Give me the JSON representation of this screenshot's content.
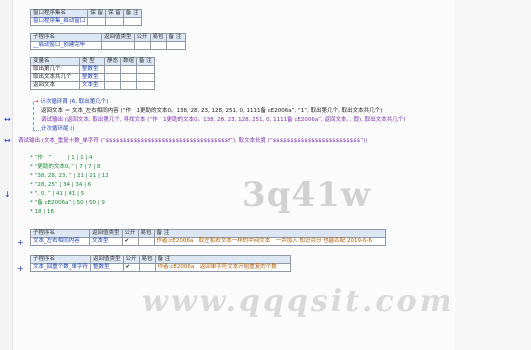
{
  "window_table": {
    "headers": [
      "窗口程序集名",
      "保 留",
      "保 留",
      "备 注"
    ],
    "row": [
      "窗口程序集_启动窗口",
      "",
      "",
      ""
    ]
  },
  "sub_table": {
    "headers": [
      "子程序名",
      "返回值类型",
      "公开",
      "易包",
      "备 注"
    ],
    "row": [
      "__启动窗口_创建完毕",
      "",
      "",
      "",
      ""
    ]
  },
  "var_table": {
    "headers": [
      "变量名",
      "类 型",
      "静态",
      "数组",
      "备 注"
    ],
    "rows": [
      [
        "取出第几个",
        "整数型",
        "",
        "",
        ""
      ],
      [
        "取出文本共几个",
        "整数型",
        "",
        "",
        ""
      ],
      [
        "返回文本",
        "文本型",
        "",
        "",
        ""
      ]
    ]
  },
  "code": {
    "loop_start": "计次循环首 (6, 取出第几个)",
    "line2": "返回文本 ＝ 文本_左右相同内容 (“作　1更助的文本0。138, 28, 23, 128, 251, 0, 1111备 cE2006a”, “1”, 取出第几个, 取出文本共几个)",
    "line3": "调试输出 (返回文本, 取出第几个, 寻找文本 (“作　1更助的文本0。138, 28, 23, 128, 251, 0, 1111备 cE2006a”, 返回文本, , 假), 取出文本共几个)",
    "loop_end": "计次循环尾 ()",
    "line5": "调试输出 (文本_重复十数_单字符 (“$$$$$$$$$$$$$$$$$$$$$$$$$$$$$$$$$$$f”), 取文本长度 (“$$$$$$$$$$$$$$$$$$$$$$$$$”))"
  },
  "output": [
    "* “作　”　　　| 1 | 1 | 4",
    "* “更助的文本0。” | 7 | 7 | 8",
    "* “38, 28, 23, ” | 21 | 21 | 12",
    "* “28, 25” | 34 | 34 | 6",
    "* “, 0, ” | 41 | 41 | 5",
    "* “备 cE2006a” | 50 | 50 | 9",
    "* 18 | 18"
  ],
  "func1": {
    "headers": [
      "子程序名",
      "返回值类型",
      "公开",
      "易包",
      "备 注"
    ],
    "row": [
      "文本_左右相同内容",
      "文本型",
      "✔",
      "",
      "作者:cE2006a　取左和右文本一样的中间文本　一并加入 知识兵分 也能匹配 2019-6-6"
    ]
  },
  "func2": {
    "headers": [
      "子程序名",
      "返回值类型",
      "公开",
      "易包",
      "备 注"
    ],
    "row": [
      "文本_回重个数_单字符",
      "整数型",
      "✔",
      "",
      "作者:cE2006a　返回单字符文本开始重复的个数"
    ]
  },
  "watermark_text": "3q41w",
  "watermark_url": "www.qqqsit.com"
}
